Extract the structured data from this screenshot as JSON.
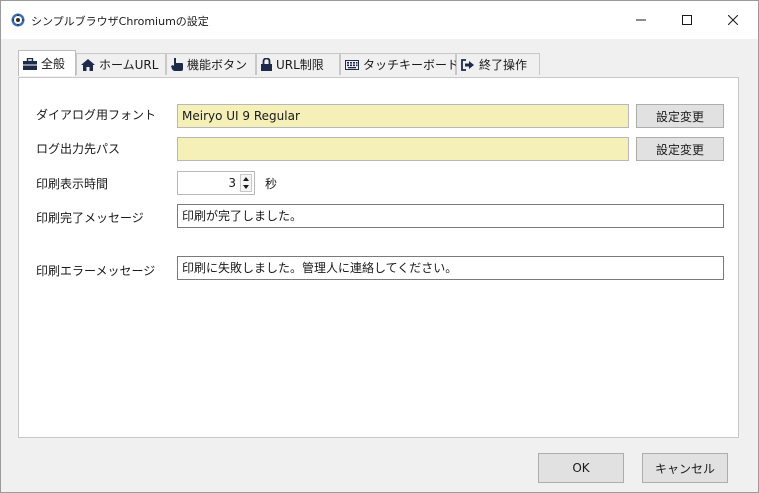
{
  "window": {
    "title": "シンプルブラウザChromiumの設定",
    "minimize": "–",
    "maximize": "□",
    "close": "✕"
  },
  "tabs": [
    {
      "label": "全般",
      "icon": "briefcase-icon",
      "active": true
    },
    {
      "label": "ホームURL",
      "icon": "home-icon"
    },
    {
      "label": "機能ボタン",
      "icon": "hand-pointer-icon"
    },
    {
      "label": "URL制限",
      "icon": "lock-icon"
    },
    {
      "label": "タッチキーボード",
      "icon": "keyboard-icon"
    },
    {
      "label": "終了操作",
      "icon": "sign-out-icon"
    }
  ],
  "general": {
    "font_label": "ダイアログ用フォント",
    "font_value": "Meiryo UI 9 Regular",
    "font_button": "設定変更",
    "log_label": "ログ出力先パス",
    "log_value": "",
    "log_button": "設定変更",
    "print_time_label": "印刷表示時間",
    "print_time_value": "3",
    "print_time_unit": "秒",
    "print_done_label": "印刷完了メッセージ",
    "print_done_value": "印刷が完了しました。",
    "print_error_label": "印刷エラーメッセージ",
    "print_error_value": "印刷に失敗しました。管理人に連絡してください。"
  },
  "footer": {
    "ok": "OK",
    "cancel": "キャンセル"
  }
}
